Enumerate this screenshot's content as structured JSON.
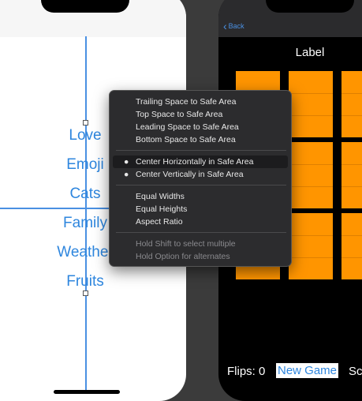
{
  "left_view": {
    "words": [
      "Love",
      "Emoji",
      "Cats",
      "Family",
      "Weather",
      "Fruits"
    ]
  },
  "right_view": {
    "nav": {
      "back_label": "Back"
    },
    "title": "Label",
    "card_color": "#ff9500",
    "card_grid": {
      "rows": 3,
      "columns": 3
    },
    "flips_label": "Flips: 0",
    "new_game_label": "New Game",
    "score_label": "Sc"
  },
  "context_menu": {
    "group1": [
      "Trailing Space to Safe Area",
      "Top Space to Safe Area",
      "Leading Space to Safe Area",
      "Bottom Space to Safe Area"
    ],
    "group2": [
      {
        "label": "Center Horizontally in Safe Area",
        "bullet": "●",
        "selected": true
      },
      {
        "label": "Center Vertically in Safe Area",
        "bullet": "●",
        "selected": false
      }
    ],
    "group3": [
      "Equal Widths",
      "Equal Heights",
      "Aspect Ratio"
    ],
    "hints": [
      "Hold Shift to select multiple",
      "Hold Option for alternates"
    ]
  },
  "colors": {
    "accent_blue": "#2e86de",
    "menu_background": "#2c2c2e",
    "left_background": "#ffffff",
    "right_background": "#000000"
  }
}
